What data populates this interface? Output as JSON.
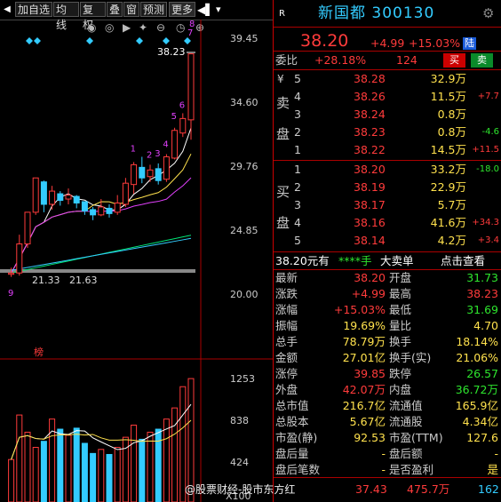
{
  "toolbar": {
    "items": [
      "加自选",
      "均线",
      "复权",
      "叠",
      "窗",
      "预测",
      "更多"
    ]
  },
  "chart": {
    "price_ticks": [
      "39.45",
      "34.60",
      "29.76",
      "24.85",
      "20.00"
    ],
    "volume_ticks": [
      "1253",
      "838",
      "424"
    ],
    "volume_unit": "X100",
    "high_label": "38.23",
    "low_label": "21.33",
    "low_label2": "21.63",
    "low_left_label": "9",
    "day_labels": [
      "1",
      "2",
      "3",
      "4",
      "5",
      "6",
      "7",
      "8"
    ],
    "bang_label": "榜",
    "colors": {
      "up": "#ff3b3b",
      "down": "#3cf",
      "ma5": "#ffffff",
      "ma10": "#ffe14d",
      "ma20": "#e040fb",
      "ma60": "#00e676"
    }
  },
  "chart_data": {
    "type": "candlestick",
    "ylim": [
      20.0,
      39.45
    ],
    "candles": [
      {
        "o": 21.5,
        "c": 21.6,
        "h": 22.0,
        "l": 21.3
      },
      {
        "o": 21.6,
        "c": 23.8,
        "h": 24.5,
        "l": 21.4
      },
      {
        "o": 23.8,
        "c": 26.2,
        "h": 26.2,
        "l": 23.5
      },
      {
        "o": 26.2,
        "c": 28.8,
        "h": 28.8,
        "l": 26.0
      },
      {
        "o": 28.5,
        "c": 26.8,
        "h": 28.6,
        "l": 26.2
      },
      {
        "o": 26.8,
        "c": 27.8,
        "h": 28.2,
        "l": 26.4
      },
      {
        "o": 27.6,
        "c": 27.1,
        "h": 27.8,
        "l": 26.7
      },
      {
        "o": 27.2,
        "c": 27.5,
        "h": 28.0,
        "l": 26.8
      },
      {
        "o": 27.4,
        "c": 26.9,
        "h": 27.5,
        "l": 26.5
      },
      {
        "o": 27.0,
        "c": 26.3,
        "h": 27.0,
        "l": 26.0
      },
      {
        "o": 26.4,
        "c": 26.0,
        "h": 26.6,
        "l": 25.6
      },
      {
        "o": 26.0,
        "c": 26.6,
        "h": 27.2,
        "l": 25.9
      },
      {
        "o": 26.5,
        "c": 26.1,
        "h": 26.8,
        "l": 25.8
      },
      {
        "o": 26.2,
        "c": 26.9,
        "h": 27.5,
        "l": 26.0
      },
      {
        "o": 26.8,
        "c": 28.4,
        "h": 28.8,
        "l": 26.6
      },
      {
        "o": 28.3,
        "c": 29.8,
        "h": 30.0,
        "l": 27.6
      },
      {
        "o": 29.6,
        "c": 28.8,
        "h": 30.4,
        "l": 28.4
      },
      {
        "o": 28.9,
        "c": 29.4,
        "h": 29.8,
        "l": 28.5
      },
      {
        "o": 29.5,
        "c": 28.6,
        "h": 29.9,
        "l": 28.3
      },
      {
        "o": 28.7,
        "c": 30.4,
        "h": 30.6,
        "l": 28.5
      },
      {
        "o": 30.3,
        "c": 32.4,
        "h": 32.6,
        "l": 30.2
      },
      {
        "o": 32.2,
        "c": 33.3,
        "h": 33.7,
        "l": 31.9
      },
      {
        "o": 33.2,
        "c": 38.2,
        "h": 38.23,
        "l": 31.69
      }
    ],
    "volumes": [
      420,
      860,
      690,
      540,
      600,
      820,
      720,
      660,
      730,
      580,
      480,
      520,
      470,
      540,
      640,
      760,
      620,
      690,
      720,
      820,
      930,
      1140,
      1220
    ]
  },
  "quote": {
    "title": "新国都 300130",
    "r_badge": "R",
    "price": "38.20",
    "change": "+4.99",
    "pct": "+15.03%",
    "lu": "陆",
    "weibi_label": "委比",
    "weibi": "+28.18%",
    "weicha": "124",
    "buy_btn": "买",
    "sell_btn": "卖",
    "sell_label1": "卖",
    "sell_label2": "盘",
    "buy_label1": "买",
    "buy_label2": "盘",
    "yen": "¥",
    "sells": [
      {
        "lvl": "5",
        "price": "38.28",
        "vol": "32.9万",
        "chg": ""
      },
      {
        "lvl": "4",
        "price": "38.26",
        "vol": "11.5万",
        "chg": "+7.7"
      },
      {
        "lvl": "3",
        "price": "38.24",
        "vol": "0.8万",
        "chg": ""
      },
      {
        "lvl": "2",
        "price": "38.23",
        "vol": "0.8万",
        "chg": "-4.6"
      },
      {
        "lvl": "1",
        "price": "38.22",
        "vol": "14.5万",
        "chg": "+11.5"
      }
    ],
    "buys": [
      {
        "lvl": "1",
        "price": "38.20",
        "vol": "33.2万",
        "chg": "-18.0"
      },
      {
        "lvl": "2",
        "price": "38.19",
        "vol": "22.9万",
        "chg": ""
      },
      {
        "lvl": "3",
        "price": "38.17",
        "vol": "5.7万",
        "chg": ""
      },
      {
        "lvl": "4",
        "price": "38.16",
        "vol": "41.6万",
        "chg": "+34.3"
      },
      {
        "lvl": "5",
        "price": "38.14",
        "vol": "4.2万",
        "chg": "+3.4"
      }
    ],
    "bigorder": {
      "price": "38.20元有",
      "stars": "****手",
      "label": "大卖单",
      "link": "点击查看"
    },
    "stats": [
      {
        "l": "最新",
        "v": "38.20",
        "l2": "开盘",
        "v2": "31.73"
      },
      {
        "l": "涨跌",
        "v": "+4.99",
        "l2": "最高",
        "v2": "38.23"
      },
      {
        "l": "涨幅",
        "v": "+15.03%",
        "l2": "最低",
        "v2": "31.69"
      },
      {
        "l": "振幅",
        "v": "19.69%",
        "l2": "量比",
        "v2": "4.70"
      },
      {
        "l": "总手",
        "v": "78.79万",
        "l2": "换手",
        "v2": "18.14%"
      },
      {
        "l": "金额",
        "v": "27.01亿",
        "l2": "换手(实)",
        "v2": "21.06%"
      },
      {
        "l": "涨停",
        "v": "39.85",
        "l2": "跌停",
        "v2": "26.57"
      },
      {
        "l": "外盘",
        "v": "42.07万",
        "l2": "内盘",
        "v2": "36.72万"
      },
      {
        "l": "总市值",
        "v": "216.7亿",
        "l2": "流通值",
        "v2": "165.9亿"
      },
      {
        "l": "总股本",
        "v": "5.67亿",
        "l2": "流通股",
        "v2": "4.34亿"
      },
      {
        "l": "市盈(静)",
        "v": "92.53",
        "l2": "市盈(TTM)",
        "v2": "127.6"
      },
      {
        "l": "盘后量",
        "v": "-",
        "l2": "盘后额",
        "v2": "-"
      },
      {
        "l": "盘后笔数",
        "v": "-",
        "l2": "是否盈利",
        "v2": "是"
      }
    ],
    "bottom": {
      "watermark": "@股票财经-股市东方红",
      "price": "37.43",
      "vol": "475.7万",
      "count": "162"
    }
  }
}
